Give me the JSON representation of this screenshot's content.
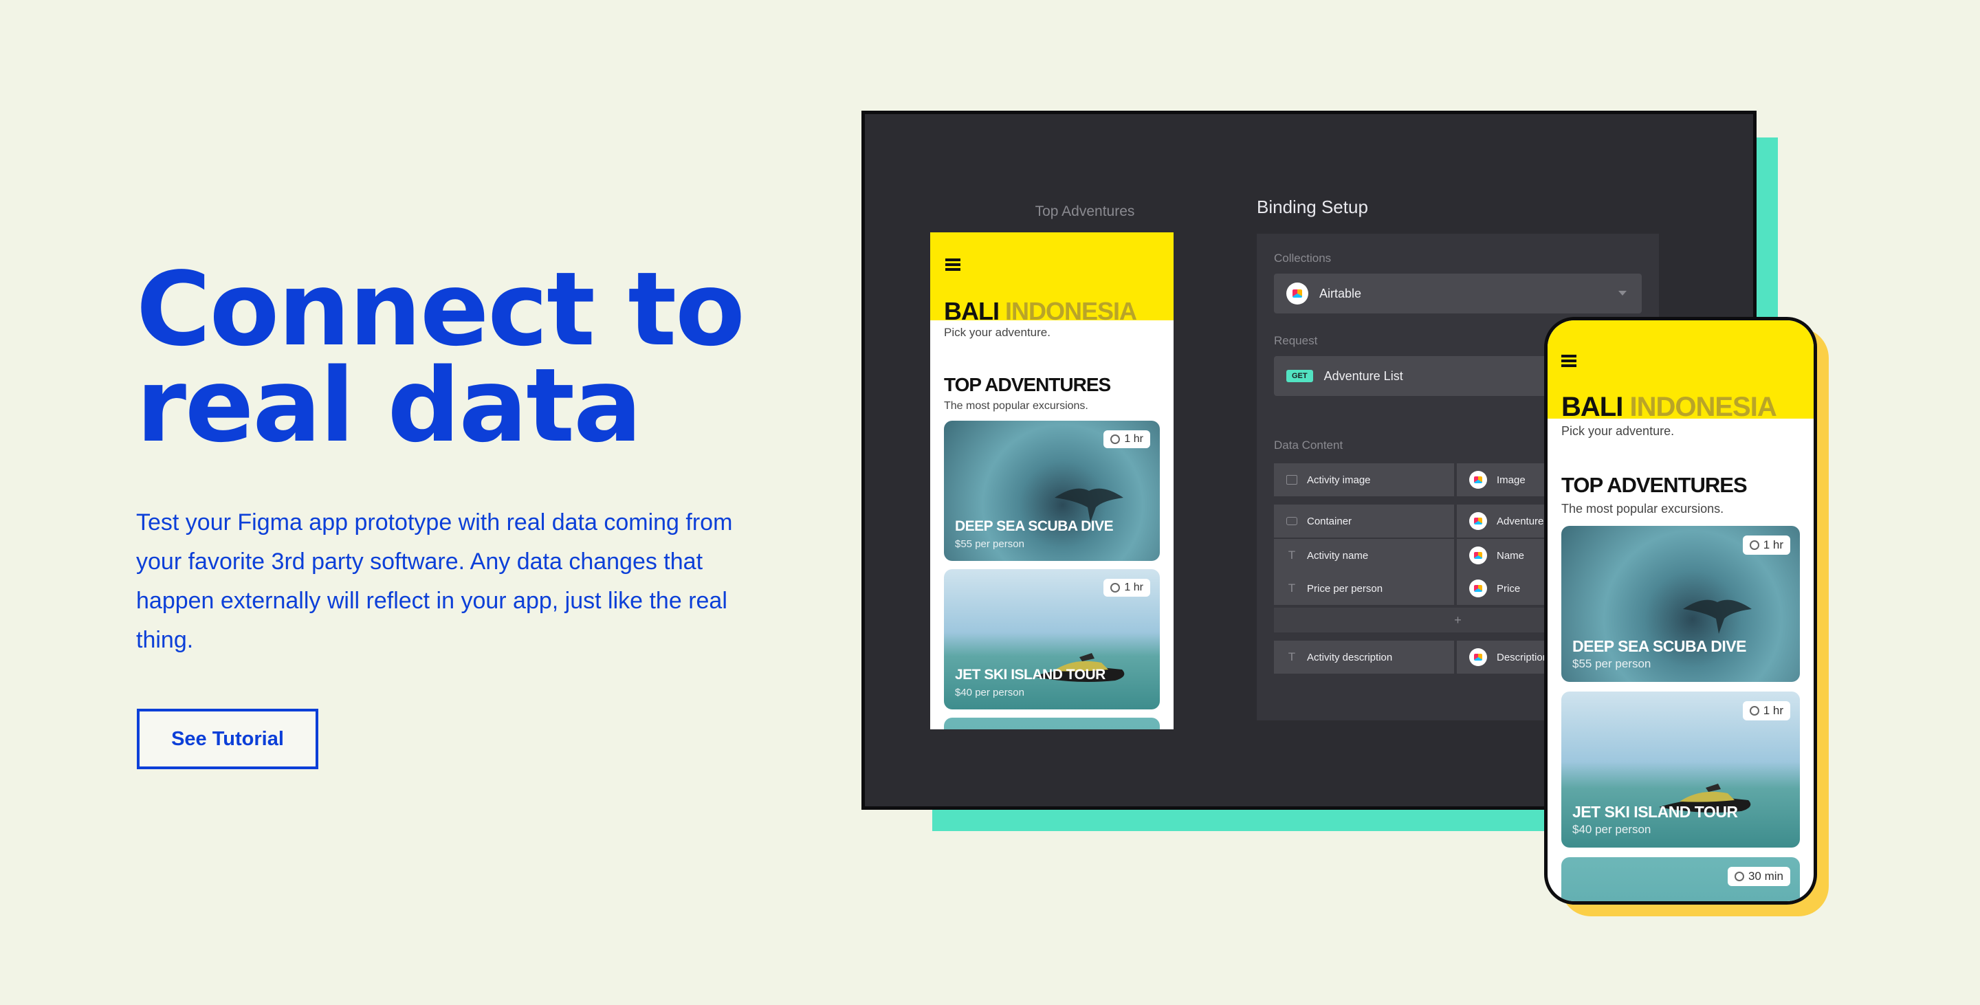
{
  "hero": {
    "headline_line1": "Connect to",
    "headline_line2": "real data",
    "body": "Test your Figma app prototype with real data coming from your favorite 3rd party software. Any data changes that happen externally will reflect in your app, just like the real thing.",
    "cta_label": "See Tutorial"
  },
  "colors": {
    "background": "#f2f4e6",
    "accent_blue": "#0c3fd8",
    "teal": "#52e3c2",
    "yellow": "#ffe900",
    "phone_shadow": "#fbcf47",
    "panel_dark": "#2c2c31"
  },
  "desktop": {
    "screen_title": "Top Adventures",
    "app": {
      "brand_word1": "BALI",
      "brand_word2": "INDONESIA",
      "tagline": "Pick your adventure.",
      "section_title": "TOP ADVENTURES",
      "section_subtitle": "The most popular excursions.",
      "cards": [
        {
          "title": "DEEP SEA SCUBA DIVE",
          "price": "$55 per person",
          "duration": "1 hr"
        },
        {
          "title": "JET SKI ISLAND TOUR",
          "price": "$40 per person",
          "duration": "1 hr"
        }
      ]
    },
    "binding": {
      "title": "Binding Setup",
      "collections_label": "Collections",
      "collection_value": "Airtable",
      "request_label": "Request",
      "request_method": "GET",
      "request_value": "Adventure List",
      "data_content_label": "Data Content",
      "rows": [
        {
          "left": "Activity image",
          "right": "Image"
        },
        {
          "left": "Container",
          "right": "Adventures"
        },
        {
          "left": "Activity name",
          "right": "Name"
        },
        {
          "left": "Price per person",
          "right": "Price"
        }
      ],
      "add_symbol": "+",
      "description_row": {
        "left": "Activity description",
        "right": "Description"
      }
    }
  },
  "phone": {
    "brand_word1": "BALI",
    "brand_word2": "INDONESIA",
    "tagline": "Pick your adventure.",
    "section_title": "TOP ADVENTURES",
    "section_subtitle": "The most popular excursions.",
    "cards": [
      {
        "title": "DEEP SEA SCUBA DIVE",
        "price": "$55 per person",
        "duration": "1 hr"
      },
      {
        "title": "JET SKI ISLAND TOUR",
        "price": "$40 per person",
        "duration": "1 hr"
      },
      {
        "duration": "30 min"
      }
    ]
  }
}
